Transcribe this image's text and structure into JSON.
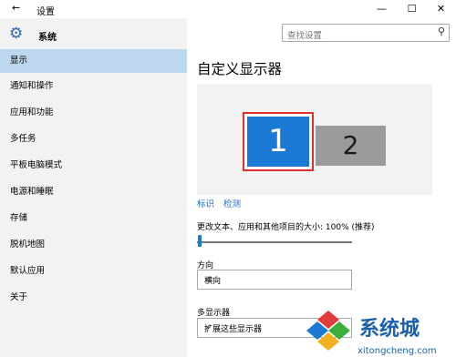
{
  "window": {
    "title": "设置",
    "back_glyph": "←",
    "minimize_glyph": "—",
    "maximize_glyph": "☐",
    "close_glyph": "✕"
  },
  "brand": {
    "label": "系统"
  },
  "search": {
    "placeholder": "查找设置"
  },
  "sidebar": {
    "items": [
      {
        "label": "显示",
        "active": true
      },
      {
        "label": "通知和操作"
      },
      {
        "label": "应用和功能"
      },
      {
        "label": "多任务"
      },
      {
        "label": "平板电脑模式"
      },
      {
        "label": "电源和睡眠"
      },
      {
        "label": "存储"
      },
      {
        "label": "脱机地图"
      },
      {
        "label": "默认应用"
      },
      {
        "label": "关于"
      }
    ]
  },
  "main": {
    "title": "自定义显示器",
    "monitor_1": "1",
    "monitor_2": "2",
    "link_identify": "标识",
    "link_detect": "检测",
    "scale_label": "更改文本、应用和其他项目的大小: 100% (推荐)",
    "scale_value_percent": 100,
    "orientation_label": "方向",
    "orientation_value": "横向",
    "multi_display_label": "多显示器",
    "multi_display_value": "扩展这些显示器"
  },
  "watermark": {
    "text": "系统城",
    "url_text": "xitongcheng.com"
  },
  "colors": {
    "accent": "#1d7ad4",
    "selected_monitor_border": "#e03131",
    "sidebar_bg": "#f2f2f2",
    "active_item": "#bcd7ee"
  }
}
